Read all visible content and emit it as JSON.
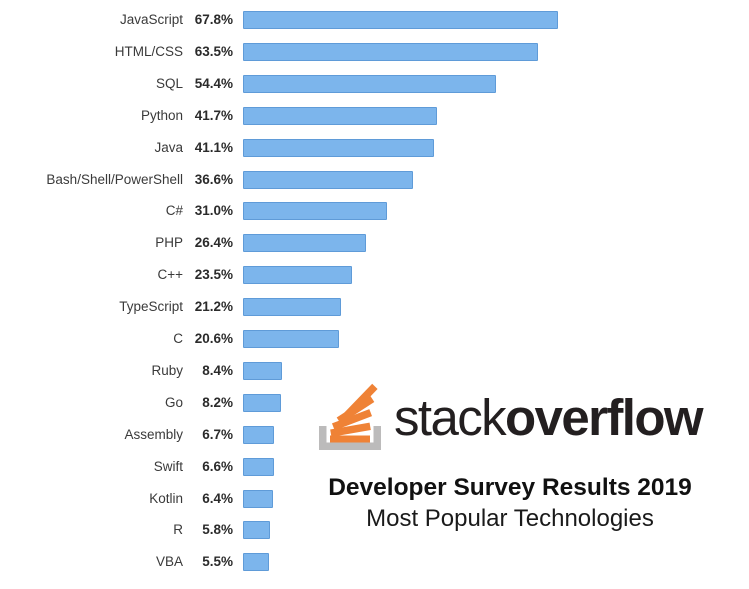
{
  "chart_data": {
    "type": "bar",
    "orientation": "horizontal",
    "title": "Developer Survey Results 2019",
    "subtitle": "Most Popular Technologies",
    "xlabel": "",
    "ylabel": "",
    "grid": false,
    "legend": "none",
    "value_suffix": "%",
    "xlim": [
      0,
      67.8
    ],
    "categories": [
      "JavaScript",
      "HTML/CSS",
      "SQL",
      "Python",
      "Java",
      "Bash/Shell/PowerShell",
      "C#",
      "PHP",
      "C++",
      "TypeScript",
      "C",
      "Ruby",
      "Go",
      "Assembly",
      "Swift",
      "Kotlin",
      "R",
      "VBA"
    ],
    "values": [
      67.8,
      63.5,
      54.4,
      41.7,
      41.1,
      36.6,
      31.0,
      26.4,
      23.5,
      21.2,
      20.6,
      8.4,
      8.2,
      6.7,
      6.6,
      6.4,
      5.8,
      5.5
    ],
    "value_labels": [
      "67.8%",
      "63.5%",
      "54.4%",
      "41.7%",
      "41.1%",
      "36.6%",
      "31.0%",
      "26.4%",
      "23.5%",
      "21.2%",
      "20.6%",
      "8.4%",
      "8.2%",
      "6.7%",
      "6.6%",
      "6.4%",
      "5.8%",
      "5.5%"
    ],
    "bar_color": "#7cb5ec",
    "bar_border_color": "#5f9bd8"
  },
  "branding": {
    "logo_name": "stack-overflow-logo",
    "wordmark_light": "stack",
    "wordmark_bold": "overflow",
    "logo_orange": "#ef8236",
    "logo_gray": "#bcbbbb",
    "wordmark_color": "#231f20"
  }
}
